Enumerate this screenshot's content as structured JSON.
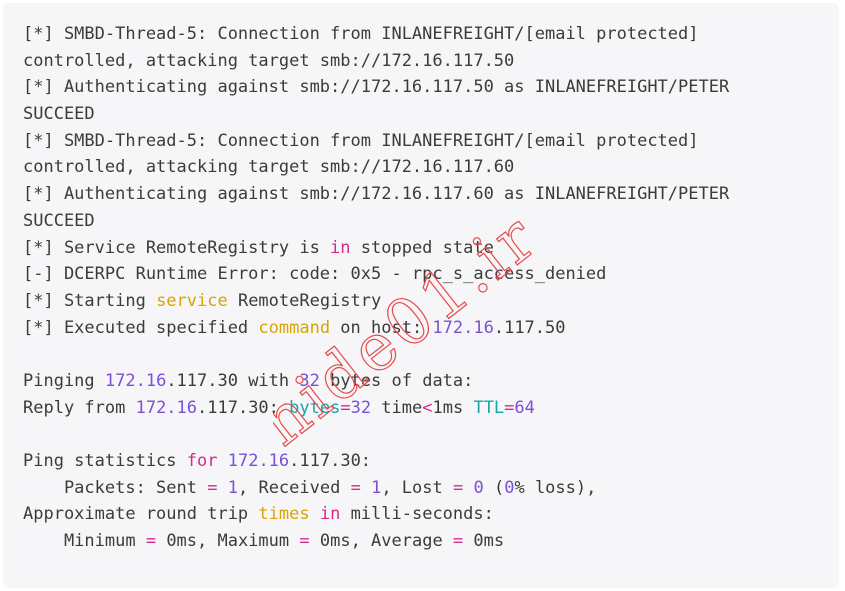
{
  "colors": {
    "background": "#f6f6f8",
    "text": "#3b3b3b",
    "keyword": "#d12c8a",
    "highlight": "#d9a400",
    "number": "#7b4fd6",
    "teal": "#16a5a8",
    "watermark": "#e84a4a"
  },
  "watermark_text": "hide01.ir",
  "lines": [
    [
      {
        "t": "[*] SMBD-Thread-5: Connection from INLANEFREIGHT/[email protected]",
        "c": "plain"
      }
    ],
    [
      {
        "t": "controlled, attacking target smb://172.16.117.50",
        "c": "plain"
      }
    ],
    [
      {
        "t": "[*] Authenticating against smb://172.16.117.50 as INLANEFREIGHT/PETER",
        "c": "plain"
      }
    ],
    [
      {
        "t": "SUCCEED",
        "c": "plain"
      }
    ],
    [
      {
        "t": "[*] SMBD-Thread-5: Connection from INLANEFREIGHT/[email protected]",
        "c": "plain"
      }
    ],
    [
      {
        "t": "controlled, attacking target smb://172.16.117.60",
        "c": "plain"
      }
    ],
    [
      {
        "t": "[*] Authenticating against smb://172.16.117.60 as INLANEFREIGHT/PETER",
        "c": "plain"
      }
    ],
    [
      {
        "t": "SUCCEED",
        "c": "plain"
      }
    ],
    [
      {
        "t": "[*] Service RemoteRegistry is ",
        "c": "plain"
      },
      {
        "t": "in",
        "c": "kw"
      },
      {
        "t": " stopped state",
        "c": "plain"
      }
    ],
    [
      {
        "t": "[-] DCERPC Runtime Error: code: 0x5 - rpc_s_access_denied",
        "c": "plain"
      }
    ],
    [
      {
        "t": "[*] Starting ",
        "c": "plain"
      },
      {
        "t": "service",
        "c": "yellow"
      },
      {
        "t": " RemoteRegistry",
        "c": "plain"
      }
    ],
    [
      {
        "t": "[*] Executed specified ",
        "c": "plain"
      },
      {
        "t": "command",
        "c": "yellow"
      },
      {
        "t": " on host: ",
        "c": "plain"
      },
      {
        "t": "172.16",
        "c": "num"
      },
      {
        "t": ".117.50",
        "c": "plain"
      }
    ],
    [],
    [
      {
        "t": "Pinging ",
        "c": "plain"
      },
      {
        "t": "172.16",
        "c": "num"
      },
      {
        "t": ".117.30 with ",
        "c": "plain"
      },
      {
        "t": "32",
        "c": "num"
      },
      {
        "t": " bytes of data:",
        "c": "plain"
      }
    ],
    [
      {
        "t": "Reply from ",
        "c": "plain"
      },
      {
        "t": "172.16",
        "c": "num"
      },
      {
        "t": ".117.30: ",
        "c": "plain"
      },
      {
        "t": "bytes",
        "c": "teal"
      },
      {
        "t": "=",
        "c": "kw"
      },
      {
        "t": "32",
        "c": "num"
      },
      {
        "t": " time",
        "c": "plain"
      },
      {
        "t": "<",
        "c": "kw"
      },
      {
        "t": "1ms ",
        "c": "plain"
      },
      {
        "t": "TTL",
        "c": "teal"
      },
      {
        "t": "=",
        "c": "kw"
      },
      {
        "t": "64",
        "c": "num"
      }
    ],
    [],
    [
      {
        "t": "Ping statistics ",
        "c": "plain"
      },
      {
        "t": "for",
        "c": "kw"
      },
      {
        "t": " ",
        "c": "plain"
      },
      {
        "t": "172.16",
        "c": "num"
      },
      {
        "t": ".117.30:",
        "c": "plain"
      }
    ],
    [
      {
        "t": "    Packets: Sent ",
        "c": "plain"
      },
      {
        "t": "=",
        "c": "kw"
      },
      {
        "t": " ",
        "c": "plain"
      },
      {
        "t": "1",
        "c": "num"
      },
      {
        "t": ", Received ",
        "c": "plain"
      },
      {
        "t": "=",
        "c": "kw"
      },
      {
        "t": " ",
        "c": "plain"
      },
      {
        "t": "1",
        "c": "num"
      },
      {
        "t": ", Lost ",
        "c": "plain"
      },
      {
        "t": "=",
        "c": "kw"
      },
      {
        "t": " ",
        "c": "plain"
      },
      {
        "t": "0",
        "c": "num"
      },
      {
        "t": " (",
        "c": "plain"
      },
      {
        "t": "0",
        "c": "num"
      },
      {
        "t": "% loss),",
        "c": "plain"
      }
    ],
    [
      {
        "t": "Approximate round trip ",
        "c": "plain"
      },
      {
        "t": "times",
        "c": "yellow"
      },
      {
        "t": " ",
        "c": "plain"
      },
      {
        "t": "in",
        "c": "kw"
      },
      {
        "t": " milli-seconds:",
        "c": "plain"
      }
    ],
    [
      {
        "t": "    Minimum ",
        "c": "plain"
      },
      {
        "t": "=",
        "c": "kw"
      },
      {
        "t": " 0ms, Maximum ",
        "c": "plain"
      },
      {
        "t": "=",
        "c": "kw"
      },
      {
        "t": " 0ms, Average ",
        "c": "plain"
      },
      {
        "t": "=",
        "c": "kw"
      },
      {
        "t": " 0ms",
        "c": "plain"
      }
    ]
  ]
}
